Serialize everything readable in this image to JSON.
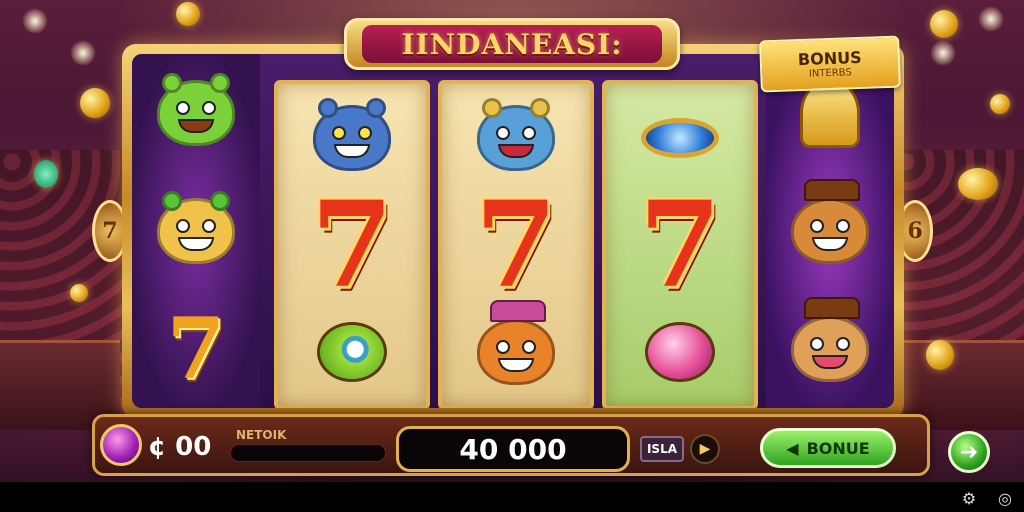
{
  "game": {
    "title": "IINDANEASI:",
    "bonus_banner": {
      "line1": "BONUS",
      "line2": "INTERBS"
    },
    "side_left_label": "7",
    "side_right_label": "6"
  },
  "reels": {
    "left_side": [
      "green-hippo-icon",
      "spiky-lion-icon",
      "seven-symbol"
    ],
    "reel1": [
      "blue-monster-icon",
      "red-seven-symbol",
      "green-flower-icon"
    ],
    "reel2": [
      "blue-creature-icon",
      "red-seven-symbol",
      "fox-cap-icon"
    ],
    "reel3": [
      "blue-ring-icon",
      "red-seven-symbol",
      "pink-orb-icon"
    ],
    "right_side": [
      "golden-bell-icon",
      "hat-bear-icon",
      "hat-dog-icon"
    ],
    "seven_text": "7"
  },
  "controls": {
    "credit": "¢ 00",
    "network_label": "NETOIK",
    "win_amount": "40 000",
    "small_label": "ISLA",
    "play_symbol": "▶",
    "bonus_button": "BONUE",
    "bonus_arrow": "◀",
    "next_arrow": "➜"
  },
  "footer": {
    "icons": [
      "puzzle-icon",
      "settings-ring-icon"
    ]
  },
  "colors": {
    "frame_gold": "#e2b254",
    "reel_cream": "#f6e4b0",
    "seven_red": "#e8331c",
    "bonus_green": "#2fa320",
    "title_magenta": "#b81f52"
  }
}
